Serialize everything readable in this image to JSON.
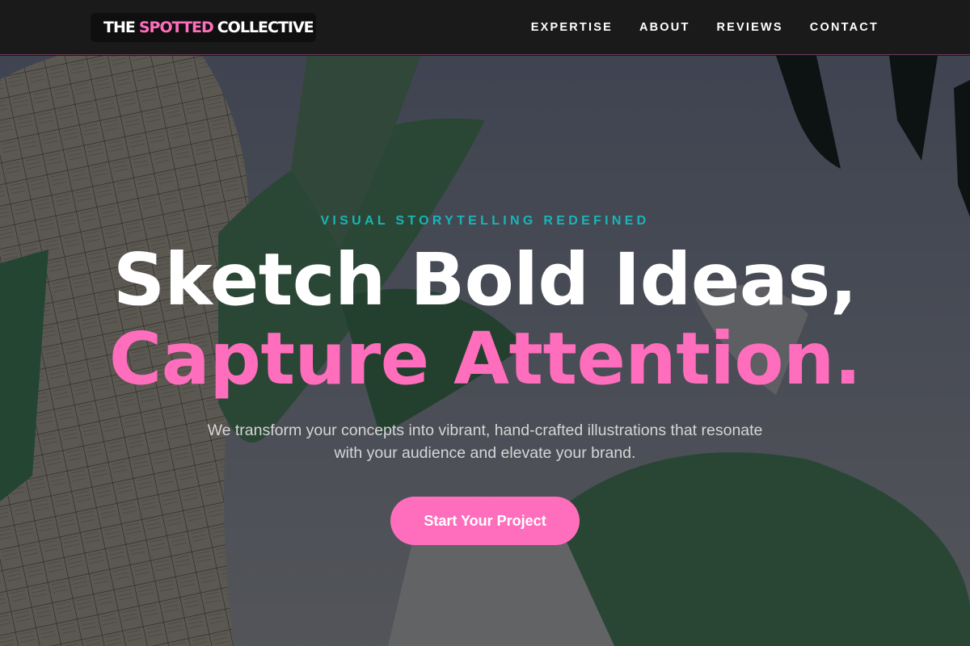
{
  "brand": {
    "prefix": "THE",
    "accent": "SPOTTED",
    "suffix": "COLLECTIVE"
  },
  "nav": {
    "items": [
      {
        "label": "EXPERTISE"
      },
      {
        "label": "ABOUT"
      },
      {
        "label": "REVIEWS"
      },
      {
        "label": "CONTACT"
      }
    ]
  },
  "hero": {
    "eyebrow": "VISUAL STORYTELLING REDEFINED",
    "headline_line1": "Sketch Bold Ideas,",
    "headline_line2": "Capture Attention.",
    "subtitle": "We transform your concepts into vibrant, hand-crafted illustrations that resonate with your audience and elevate your brand.",
    "cta_label": "Start Your Project"
  },
  "colors": {
    "accent_pink": "#ff6ebc",
    "accent_teal": "#19b5b8",
    "nav_bg": "#1a1a1a"
  }
}
